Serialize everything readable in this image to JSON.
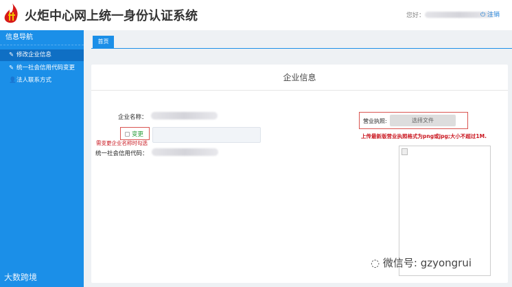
{
  "header": {
    "title": "火炬中心网上统一身份认证系统",
    "greeting": "您好：",
    "logout": "注销",
    "logout_icon": "power-icon"
  },
  "sidebar": {
    "title": "信息导航",
    "items": [
      {
        "label": "修改企业信息",
        "icon": "edit-icon",
        "active": true
      },
      {
        "label": "统一社会信用代码变更",
        "icon": "edit-icon"
      },
      {
        "label": "法人联系方式",
        "icon": "user-icon"
      }
    ]
  },
  "tabs": [
    {
      "label": "首页"
    }
  ],
  "card": {
    "title": "企业信息",
    "company_name_label": "企业名称：",
    "change_label": "变更",
    "change_hint": "需变更企业名称时勾选",
    "credit_code_label": "统一社会信用代码：",
    "license_label": "营业执照:",
    "choose_file": "选择文件",
    "upload_hint": "上传最新版营业执照格式为png或jpg;大小不超过1M."
  },
  "watermarks": {
    "left": "大数跨境",
    "right": "微信号: gzyongrui"
  },
  "colors": {
    "primary": "#1b8fe8",
    "active": "#0f6fc4",
    "error": "#c9151e"
  }
}
